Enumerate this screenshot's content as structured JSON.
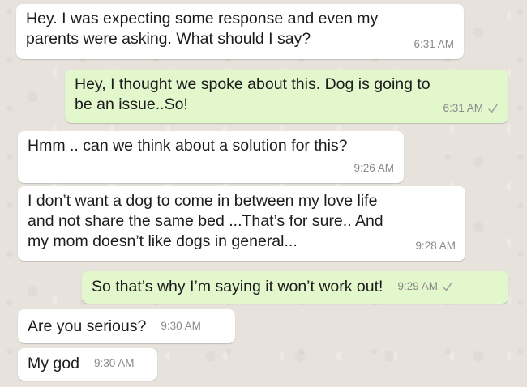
{
  "messages": [
    {
      "direction": "incoming",
      "text": "Hey. I was expecting some response and even my\nparents were asking. What should I say?",
      "time": "6:31 AM"
    },
    {
      "direction": "outgoing",
      "text": "Hey, I thought we spoke about this. Dog is going to\nbe an issue..So!",
      "time": "6:31 AM",
      "status_icon": "check-icon"
    },
    {
      "direction": "incoming",
      "text": "Hmm .. can we think about a solution for this?",
      "time": "9:26 AM"
    },
    {
      "direction": "incoming",
      "text": "I don’t want a dog to come in between my love life\nand not share the same bed ...That’s for sure.. And\nmy mom doesn’t like dogs in general...",
      "time": "9:28 AM"
    },
    {
      "direction": "outgoing",
      "text": "So that’s why I’m saying it won’t work out!",
      "time": "9:29 AM",
      "status_icon": "check-icon"
    },
    {
      "direction": "incoming",
      "text": "Are you serious?",
      "time": "9:30 AM"
    },
    {
      "direction": "incoming",
      "text": "My god",
      "time": "9:30 AM"
    }
  ],
  "colors": {
    "incoming_bubble": "#ffffff",
    "outgoing_bubble": "#e2f7cb",
    "timestamp": "#8a8a8a",
    "background": "#e7e3dc"
  }
}
